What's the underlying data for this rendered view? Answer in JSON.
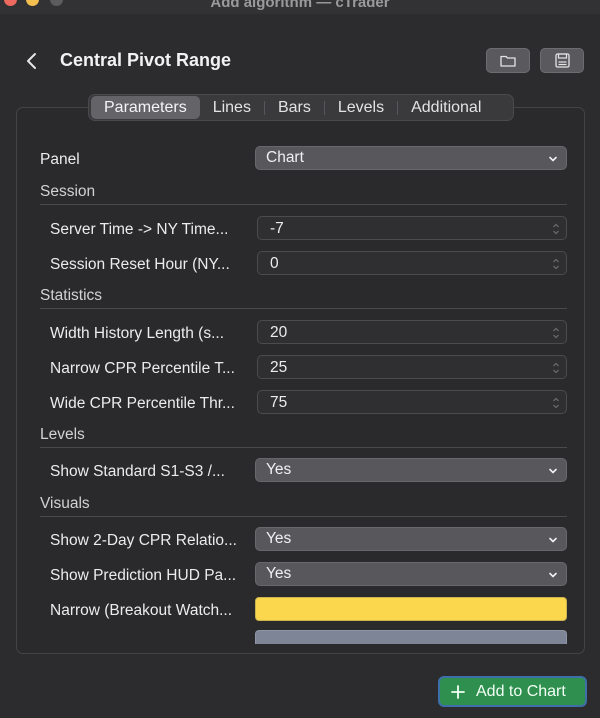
{
  "window": {
    "title": "Add algorithm — cTrader"
  },
  "header": {
    "title": "Central Pivot Range",
    "folder_icon": "folder-icon",
    "save_icon": "save-icon"
  },
  "tabs": [
    {
      "label": "Parameters",
      "active": true
    },
    {
      "label": "Lines",
      "active": false
    },
    {
      "label": "Bars",
      "active": false
    },
    {
      "label": "Levels",
      "active": false
    },
    {
      "label": "Additional",
      "active": false
    }
  ],
  "panel_row": {
    "label": "Panel",
    "value": "Chart"
  },
  "sections": {
    "session": {
      "title": "Session",
      "rows": [
        {
          "label": "Server Time -> NY Time...",
          "value": "-7"
        },
        {
          "label": "Session Reset Hour (NY...",
          "value": "0"
        }
      ]
    },
    "statistics": {
      "title": "Statistics",
      "rows": [
        {
          "label": "Width History Length (s...",
          "value": "20"
        },
        {
          "label": "Narrow CPR Percentile T...",
          "value": "25"
        },
        {
          "label": "Wide CPR Percentile Thr...",
          "value": "75"
        }
      ]
    },
    "levels": {
      "title": "Levels",
      "rows": [
        {
          "label": "Show Standard S1-S3 /...",
          "value": "Yes"
        }
      ]
    },
    "visuals": {
      "title": "Visuals",
      "rows": [
        {
          "label": "Show 2-Day CPR Relatio...",
          "value": "Yes"
        },
        {
          "label": "Show Prediction HUD Pa...",
          "value": "Yes"
        },
        {
          "label": "Narrow (Breakout Watch...",
          "color": "#fbd74e"
        }
      ]
    }
  },
  "footer": {
    "add_button_label": "Add to Chart"
  },
  "colors": {
    "accent_green": "#2f8f4e",
    "focus_ring": "#3d6fa8",
    "swatch_yellow": "#fbd74e"
  }
}
